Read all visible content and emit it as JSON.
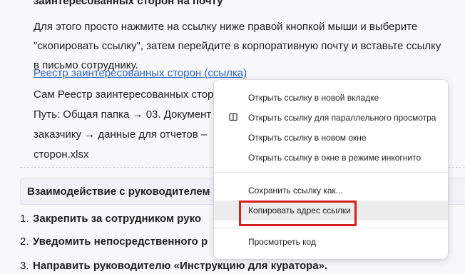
{
  "document": {
    "heading_partial": "заинтересованных сторон на почту",
    "paragraph_lines": [
      "Для этого просто нажмите на ссылку ниже правой кнопкой мыши и выберите",
      "\"скопировать ссылку\", затем перейдите в корпоративную почту и вставьте ссылку",
      "в письмо сотруднику."
    ],
    "link_text": "Реестр заинтересованных сторон (ссылка)",
    "text_lines": [
      "Сам Реестр заинтересованных стор",
      "Путь: Общая папка → 03. Документ",
      "заказчику → данные для отчетов –",
      "сторон.xlsx"
    ],
    "section_title": "Взаимодействие с руководителем",
    "list_items": [
      {
        "num": "1.",
        "text": "Закрепить за сотрудником руко"
      },
      {
        "num": "2.",
        "text": "Уведомить непосредственного р"
      },
      {
        "num": "3.",
        "text": "Направить руководителю «Инструкцию для куратора»."
      }
    ]
  },
  "context_menu": {
    "items": [
      {
        "label": "Открыть ссылку в новой вкладке",
        "icon": ""
      },
      {
        "label": "Открыть ссылку для параллельного просмотра",
        "icon": "split-view-icon"
      },
      {
        "label": "Открыть ссылку в новом окне",
        "icon": ""
      },
      {
        "label": "Открыть ссылку в окне в режиме инкогнито",
        "icon": ""
      },
      {
        "label": "Сохранить ссылку как...",
        "icon": ""
      },
      {
        "label": "Копировать адрес ссылки",
        "icon": "",
        "highlighted": true
      },
      {
        "label": "Просмотреть код",
        "icon": ""
      }
    ]
  },
  "colors": {
    "link": "#2f63c2",
    "highlight_box": "#d42020",
    "menu_hover": "#ececec"
  }
}
